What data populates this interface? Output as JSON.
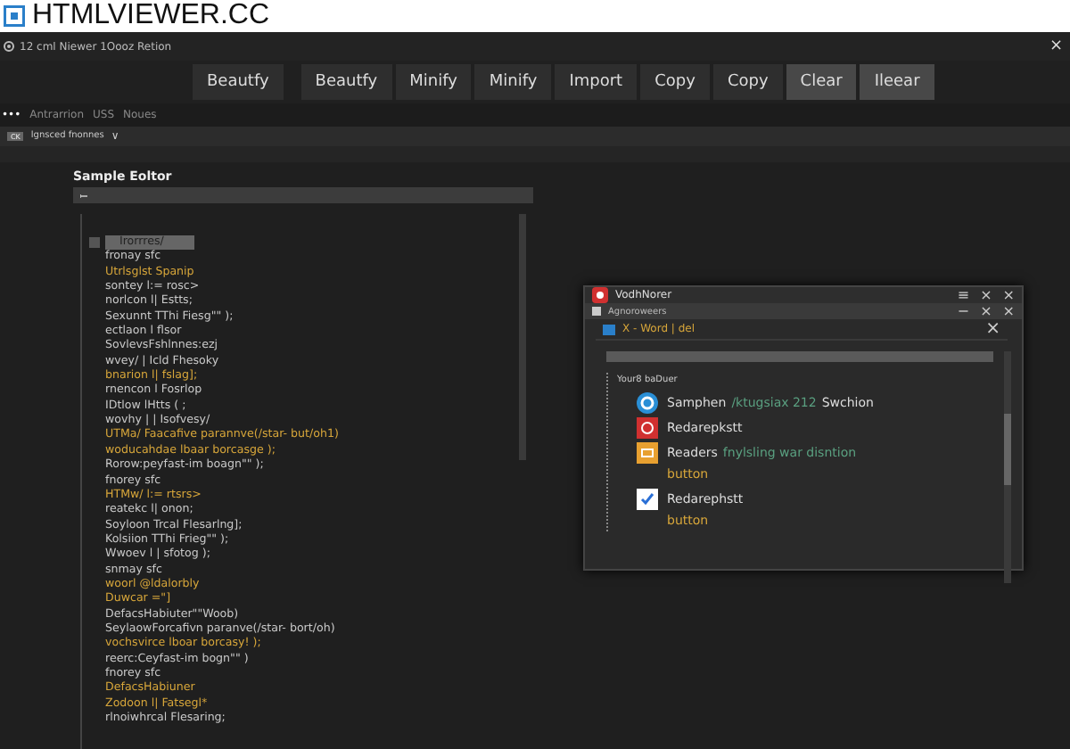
{
  "header": {
    "logo_text": "HTMLVIEWER.CC"
  },
  "window": {
    "title": "12 cml Niewer 1Oooz Retion",
    "close": "×"
  },
  "toolbar": [
    {
      "label": "Beautfy",
      "kind": "dark"
    },
    {
      "label": "Beautfy",
      "kind": "dark"
    },
    {
      "label": "Minify",
      "kind": "dark"
    },
    {
      "label": "Minify",
      "kind": "dark"
    },
    {
      "label": "Import",
      "kind": "dark"
    },
    {
      "label": "Copy",
      "kind": "dark"
    },
    {
      "label": "Copy",
      "kind": "dark"
    },
    {
      "label": "Clear",
      "kind": "light"
    },
    {
      "label": "Ileear",
      "kind": "light"
    }
  ],
  "nav": {
    "dots": "•••",
    "items": [
      "Antrarrion",
      "USS",
      "Noues"
    ]
  },
  "filter_bar": {
    "badge": "CK",
    "label": "lgnsced fnonnes",
    "caret": "∨"
  },
  "editor": {
    "title": "Sample Eoltor",
    "checked": false,
    "lines": [
      {
        "text": "Irorrres/",
        "kind": "selected"
      },
      {
        "text": "fronay sfc",
        "kind": "plain"
      },
      {
        "text": "Utrlsglst Spanip",
        "kind": "accent"
      },
      {
        "text": "sontey l:=   rosc>",
        "kind": "plain"
      },
      {
        "text": "norlcon l| Estts;",
        "kind": "plain"
      },
      {
        "text": "Sexunnt TThi Fiesg\"\" );",
        "kind": "plain"
      },
      {
        "text": "ectlaon l flsor",
        "kind": "plain"
      },
      {
        "text": "SovlevsFshlnnes:ezj",
        "kind": "plain"
      },
      {
        "text": "wvey/ | Icld Fhesoky",
        "kind": "plain"
      },
      {
        "text": "bnarion l| fslag];",
        "kind": "accent"
      },
      {
        "text": "rnencon l Fosrlop",
        "kind": "plain"
      },
      {
        "text": "IDtlow lHtts ( ;",
        "kind": "plain"
      },
      {
        "text": "wovhy | | Isofvesy/",
        "kind": "plain"
      },
      {
        "text": "UTMa/ Faacafive parannve(/star- but/oh1)",
        "kind": "accent"
      },
      {
        "text": "woducahdae lbaar borcasge );",
        "kind": "accent"
      },
      {
        "text": "Rorow:peyfast-im boagn\"\" );",
        "kind": "plain"
      },
      {
        "text": "fnorey sfc",
        "kind": "plain"
      },
      {
        "text": "HTMw/ l:=   rtsrs>",
        "kind": "accent"
      },
      {
        "text": "reatekc l| onon;",
        "kind": "plain"
      },
      {
        "text": "Soyloon Trcal Flesarlng];",
        "kind": "plain"
      },
      {
        "text": "Kolsiion TThi Frieg\"\" );",
        "kind": "plain"
      },
      {
        "text": "Wwoev l | sfotog );",
        "kind": "plain"
      },
      {
        "text": "snmay sfc",
        "kind": "plain"
      },
      {
        "text": "woorl @ldalorbly",
        "kind": "accent"
      },
      {
        "text": "Duwcar =\"]",
        "kind": "accent"
      },
      {
        "text": "DefacsHabiuter\"\"Woob)",
        "kind": "plain"
      },
      {
        "text": "SeylaowForcafivn paranve(/star- bort/oh)",
        "kind": "plain"
      },
      {
        "text": "vochsvirce lboar borcasy! );",
        "kind": "accent"
      },
      {
        "text": "reerc:Ceyfast-im bogn\"\" )",
        "kind": "plain"
      },
      {
        "text": "fnorey sfc",
        "kind": "plain"
      },
      {
        "text": "DefacsHabiuner",
        "kind": "accent"
      },
      {
        "text": "Zodoon l| Fatsegl*",
        "kind": "accent"
      },
      {
        "text": "rlnoiwhrcal Flesaring;",
        "kind": "plain"
      }
    ]
  },
  "popup": {
    "title": "VodhNorer",
    "title_buttons": [
      "≡",
      "×",
      "×"
    ],
    "panel_title": "Agnoroweers",
    "panel_buttons": [
      "−",
      "×",
      "×"
    ],
    "tab_title": "X - Word | del",
    "tab_close": "×",
    "tree_label": "Your8 baDuer",
    "items": [
      {
        "kind": "circle",
        "label": "Samphen",
        "note": "/ktugsiax 212",
        "tail": "Swchion"
      },
      {
        "kind": "stop",
        "label": "Redarepkstt"
      },
      {
        "kind": "box",
        "label": "Readers",
        "note": "fnylsling war disntion",
        "sub": "button"
      },
      {
        "kind": "check",
        "label": "Redarephstt",
        "sub": "button",
        "checked": true
      }
    ]
  }
}
